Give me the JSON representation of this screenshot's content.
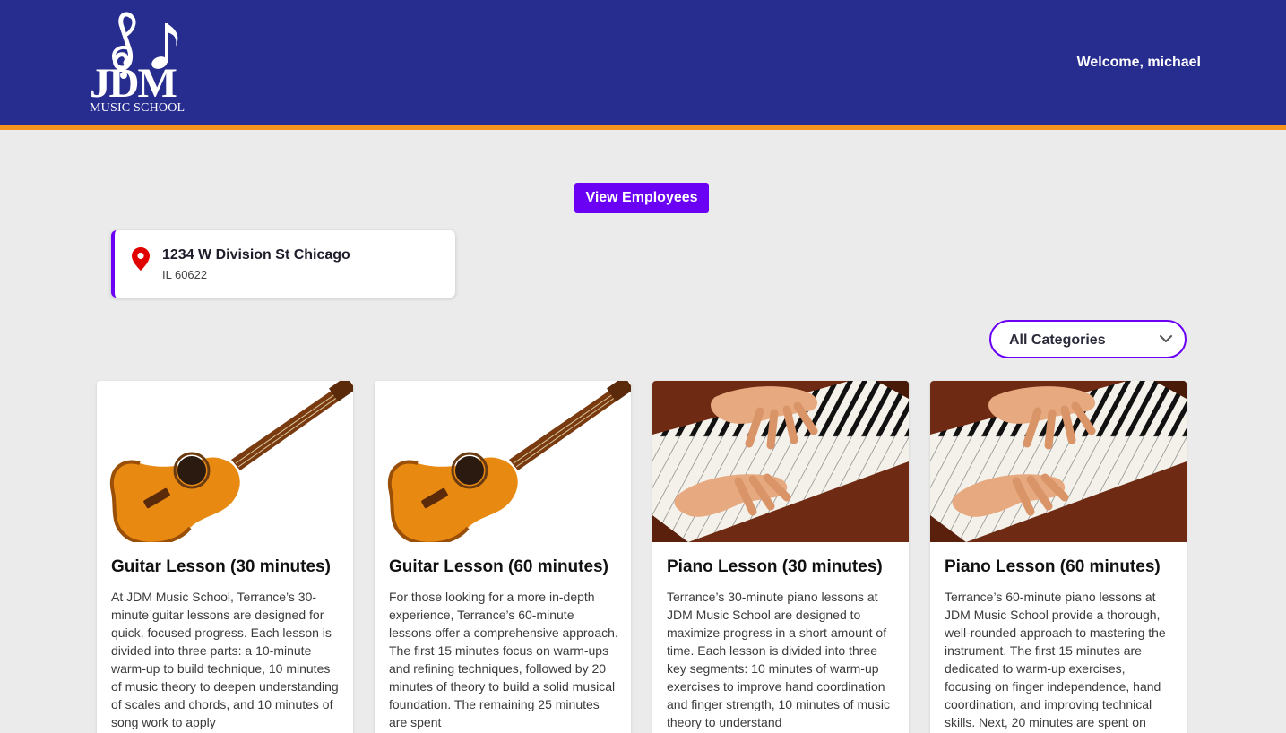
{
  "header": {
    "logo": {
      "main": "JDM",
      "sub": "MUSIC SCHOOL",
      "icon": "music-notes-icon"
    },
    "welcome": "Welcome, michael"
  },
  "actions": {
    "view_employees": "View Employees"
  },
  "location": {
    "icon": "map-pin-icon",
    "line1": "1234 W Division St Chicago",
    "line2": "IL 60622"
  },
  "filter": {
    "selected": "All Categories",
    "icon": "chevron-down-icon"
  },
  "lessons": [
    {
      "title": "Guitar Lesson (30 minutes)",
      "image": "acoustic-guitar-photo",
      "description": "At JDM Music School, Terrance’s 30-minute guitar lessons are designed for quick, focused progress. Each lesson is divided into three parts: a 10-minute warm-up to build technique, 10 minutes of music theory to deepen understanding of scales and chords, and 10 minutes of song work to apply"
    },
    {
      "title": "Guitar Lesson (60 minutes)",
      "image": "acoustic-guitar-photo",
      "description": "For those looking for a more in-depth experience, Terrance’s 60-minute lessons offer a comprehensive approach. The first 15 minutes focus on warm-ups and refining techniques, followed by 20 minutes of theory to build a solid musical foundation. The remaining 25 minutes are spent"
    },
    {
      "title": "Piano Lesson (30 minutes)",
      "image": "piano-hands-photo",
      "description": "Terrance’s 30-minute piano lessons at JDM Music School are designed to maximize progress in a short amount of time. Each lesson is divided into three key segments: 10 minutes of warm-up exercises to improve hand coordination and finger strength, 10 minutes of music theory to understand"
    },
    {
      "title": "Piano Lesson (60 minutes)",
      "image": "piano-hands-photo",
      "description": "Terrance’s 60-minute piano lessons at JDM Music School provide a thorough, well-rounded approach to mastering the instrument. The first 15 minutes are dedicated to warm-up exercises, focusing on finger independence, hand coordination, and improving technical skills. Next, 20 minutes are spent on"
    }
  ],
  "colors": {
    "header": "#272c8f",
    "stripe": "#f7941d",
    "accent": "#6a00f4",
    "background": "#ebebeb",
    "pin": "#e00000"
  }
}
